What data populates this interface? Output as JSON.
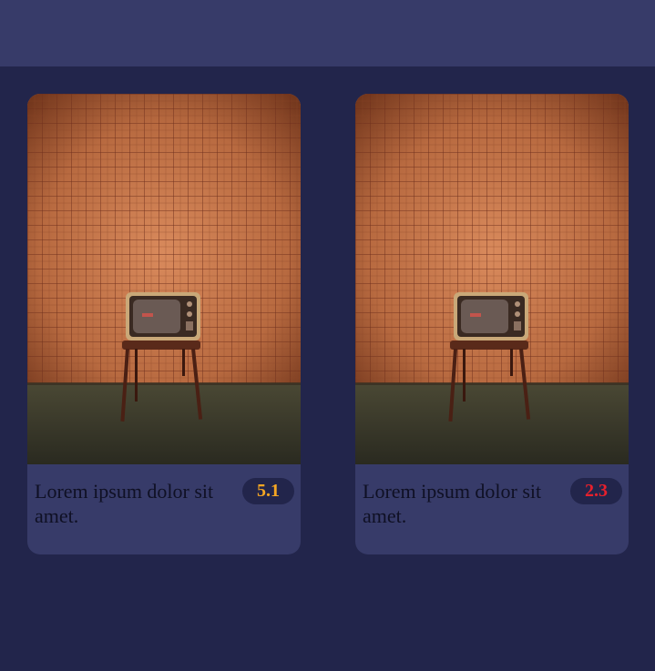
{
  "movies": [
    {
      "title": "Lorem ipsum dolor sit amet.",
      "rating": "5.1",
      "rating_color": "#f5a623"
    },
    {
      "title": "Lorem ipsum dolor sit amet.",
      "rating": "2.3",
      "rating_color": "#e8202c"
    }
  ],
  "colors": {
    "background": "#22254b",
    "header": "#373b69",
    "card": "#373b69",
    "badge": "#22254b"
  }
}
